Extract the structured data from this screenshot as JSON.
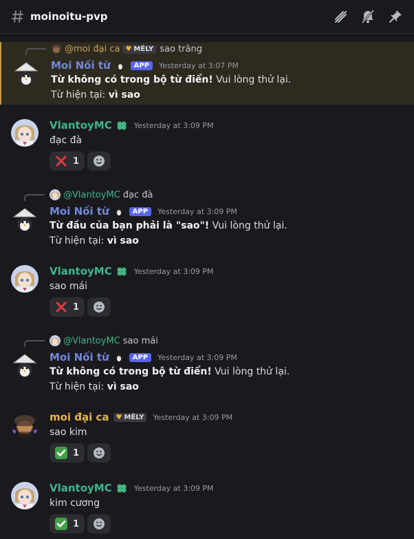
{
  "header": {
    "channel_name": "moinoitu-pvp"
  },
  "colors": {
    "highlight_bg": "#2e2a1f",
    "highlight_border": "#c79a3d",
    "app_badge": "#5865f2",
    "vlantoy": "#3fb58b",
    "moi": "#e7b44a"
  },
  "messages": [
    {
      "reply": {
        "name": "@moi đại ca",
        "badge": "MÊLY",
        "text": "sao trăng"
      },
      "author": "Moi Nối từ",
      "badge": "APP",
      "timestamp": "Yesterday at 3:07 PM",
      "bold": "Từ không có trong bộ từ điển!",
      "normal": " Vui lòng thử lại.",
      "current_prefix": "Từ hiện tại: ",
      "current_word": "vì sao"
    },
    {
      "author": "VlantoyMC",
      "timestamp": "Yesterday at 3:09 PM",
      "text": "đạc đà",
      "reaction": {
        "emoji": "cross-mark",
        "count": "1"
      }
    },
    {
      "reply": {
        "name": "@VlantoyMC",
        "text": "đạc đà"
      },
      "author": "Moi Nối từ",
      "badge": "APP",
      "timestamp": "Yesterday at 3:09 PM",
      "bold": "Từ đầu của bạn phải là \"sao\"!",
      "normal": " Vui lòng thử lại.",
      "current_prefix": "Từ hiện tại: ",
      "current_word": "vì sao"
    },
    {
      "author": "VlantoyMC",
      "timestamp": "Yesterday at 3:09 PM",
      "text": "sao mái",
      "reaction": {
        "emoji": "cross-mark",
        "count": "1"
      }
    },
    {
      "reply": {
        "name": "@VlantoyMC",
        "text": "sao mái"
      },
      "author": "Moi Nối từ",
      "badge": "APP",
      "timestamp": "Yesterday at 3:09 PM",
      "bold": "Từ không có trong bộ từ điển!",
      "normal": " Vui lòng thử lại.",
      "current_prefix": "Từ hiện tại: ",
      "current_word": "vì sao"
    },
    {
      "author": "moi đại ca",
      "badge": "MÊLY",
      "timestamp": "Yesterday at 3:09 PM",
      "text": "sao kim",
      "reaction": {
        "emoji": "check-mark",
        "count": "1"
      }
    },
    {
      "author": "VlantoyMC",
      "timestamp": "Yesterday at 3:09 PM",
      "text": "kim cương",
      "reaction": {
        "emoji": "check-mark",
        "count": "1"
      }
    }
  ]
}
